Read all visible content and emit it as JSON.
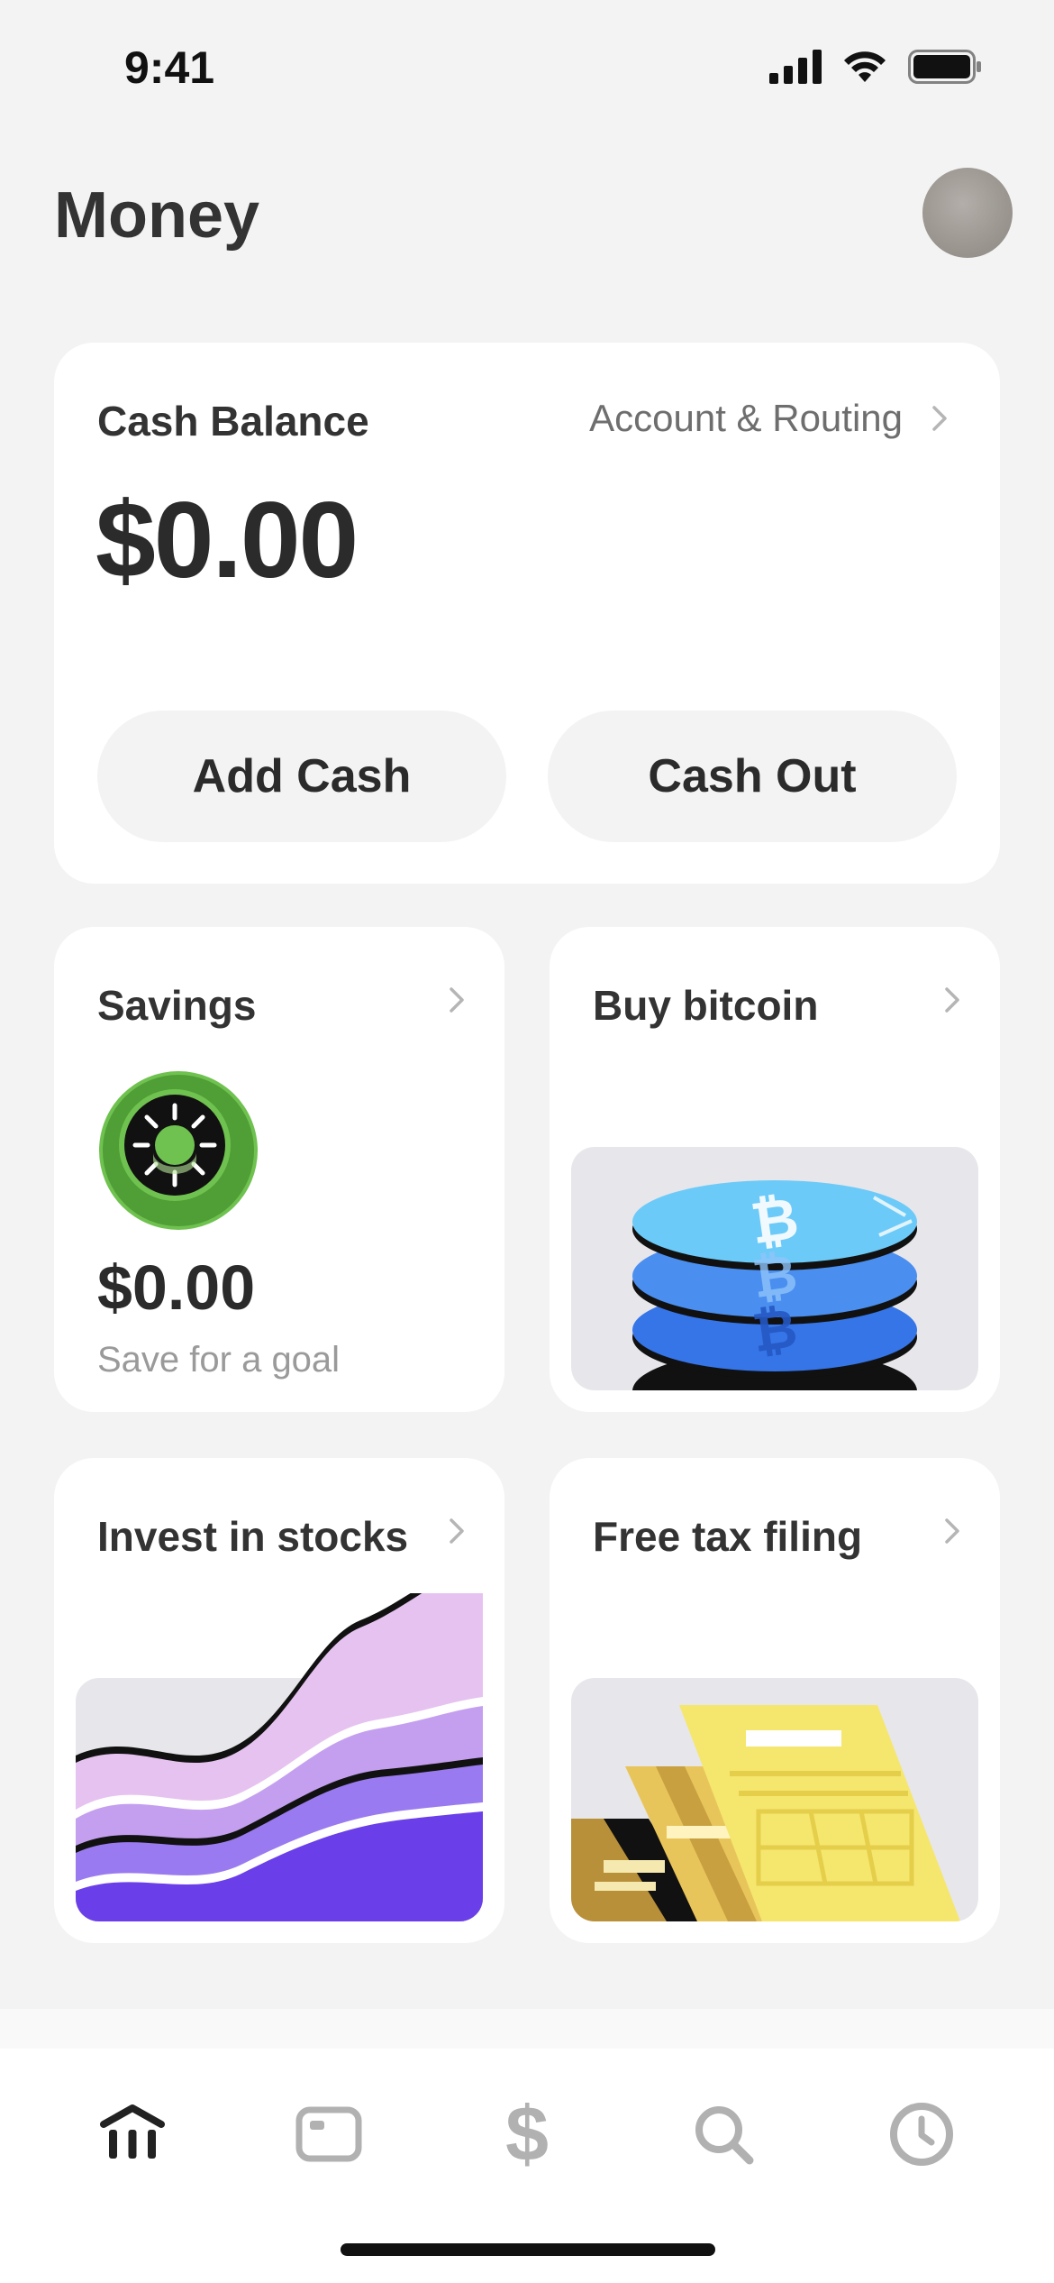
{
  "status_bar": {
    "time": "9:41"
  },
  "header": {
    "title": "Money"
  },
  "balance_card": {
    "label": "Cash Balance",
    "routing_label": "Account & Routing",
    "amount": "$0.00",
    "add_cash_label": "Add Cash",
    "cash_out_label": "Cash Out"
  },
  "tiles": {
    "savings": {
      "title": "Savings",
      "amount": "$0.00",
      "subtitle": "Save for a goal"
    },
    "bitcoin": {
      "title": "Buy bitcoin"
    },
    "stocks": {
      "title": "Invest in stocks"
    },
    "tax": {
      "title": "Free tax filing"
    }
  },
  "tab_bar": {
    "tabs": [
      {
        "icon": "home-icon",
        "active": true
      },
      {
        "icon": "card-icon",
        "active": false
      },
      {
        "icon": "dollar-icon",
        "glyph": "$",
        "active": false
      },
      {
        "icon": "search-icon",
        "active": false
      },
      {
        "icon": "clock-icon",
        "active": false
      }
    ]
  },
  "colors": {
    "background": "#f3f3f3",
    "card": "#ffffff",
    "text": "#2b2b2b",
    "muted": "#9a9a9a",
    "savings_green": "#6fc24f",
    "bitcoin_blue": "#4aa3f0",
    "stocks_purple": "#6a3ee8",
    "tax_yellow": "#f5e66e"
  }
}
